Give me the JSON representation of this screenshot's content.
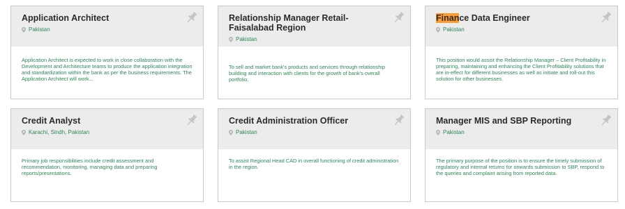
{
  "cards": [
    {
      "title": "Application Architect",
      "title_highlight": "",
      "title_rest": "",
      "location": "Pakistan",
      "description": "Application Architect is expected to work in close collaboration with the Development and Architecture teams to produce the application integration and standardization within the bank as per the business requirements. The Application Architect will work..."
    },
    {
      "title": "Relationship Manager Retail-Faisalabad Region",
      "title_highlight": "",
      "title_rest": "",
      "location": "Pakistan",
      "description": "To sell and market bank's products and services through relationship building and interaction with clients for the growth of bank's overall portfolio."
    },
    {
      "title": "",
      "title_highlight": "Finan",
      "title_rest": "ce Data Engineer",
      "location": "Pakistan",
      "description": "This position would assist the Relationship Manager – Client Profitability in preparing, maintaining and enhancing the Client Profitability solutions that are in-effect for different businesses as well as initiate and roll-out this solution for other businesses."
    },
    {
      "title": "Credit Analyst",
      "title_highlight": "",
      "title_rest": "",
      "location": "Karachi, Sindh, Pakistan",
      "description": "Primary job responsibilities include credit assessment and recommendation, monitoring, managing data and preparing reports/presentations."
    },
    {
      "title": "Credit Administration Officer",
      "title_highlight": "",
      "title_rest": "",
      "location": "Pakistan",
      "description": "To assist Regional Head CAD in overall functioning of credit administration in the region."
    },
    {
      "title": "Manager MIS and SBP Reporting",
      "title_highlight": "",
      "title_rest": "",
      "location": "Pakistan",
      "description": "The primary purpose of the position is to ensure the timely submission of regulatory and internal returns for onwards submission to SBP, respond to the queries and complaint arising from reported data."
    }
  ],
  "colors": {
    "header_bg": "#ececec",
    "location_text": "#2a8a55",
    "description_text": "#2a8a55",
    "title_text": "#2b2b2b",
    "highlight": "#ff9a2e"
  },
  "icons": {
    "pin": "pushpin-icon",
    "location": "map-marker-icon"
  }
}
